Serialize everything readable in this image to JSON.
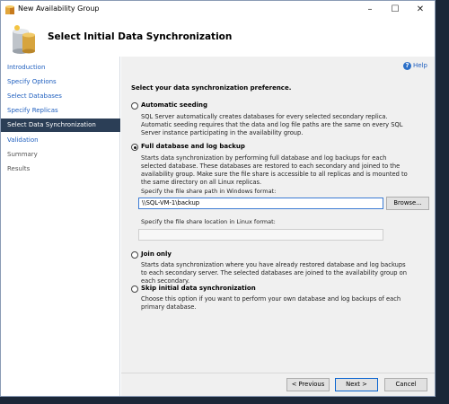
{
  "window": {
    "title": "New Availability Group"
  },
  "header": {
    "title": "Select Initial Data Synchronization"
  },
  "sidebar": {
    "items": [
      {
        "label": "Introduction"
      },
      {
        "label": "Specify Options"
      },
      {
        "label": "Select Databases"
      },
      {
        "label": "Specify Replicas"
      },
      {
        "label": "Select Data Synchronization"
      },
      {
        "label": "Validation"
      },
      {
        "label": "Summary"
      },
      {
        "label": "Results"
      }
    ]
  },
  "help": {
    "label": "Help"
  },
  "main": {
    "prompt": "Select your data synchronization preference.",
    "options": {
      "automatic": {
        "label": "Automatic seeding",
        "description": "SQL Server automatically creates databases for every selected secondary replica. Automatic seeding requires that the data and log file paths are the same on every SQL Server instance participating in the availability group."
      },
      "full": {
        "label": "Full database and log backup",
        "description": "Starts data synchronization by performing full database and log backups for each selected database. These databases are restored to each secondary and joined to the availability group. Make sure the file share is accessible to all replicas and is mounted to the same directory on all Linux replicas.",
        "windows_path_label": "Specify the file share path in Windows format:",
        "windows_path_value": "\\\\SQL-VM-1\\backup",
        "browse_label": "Browse...",
        "linux_path_label": "Specify the file share location in Linux format:",
        "linux_path_value": ""
      },
      "join": {
        "label": "Join only",
        "description": "Starts data synchronization where you have already restored database and log backups to each secondary server. The selected databases are joined to the availability group on each secondary."
      },
      "skip": {
        "label": "Skip initial data synchronization",
        "description": "Choose this option if you want to perform your own database and log backups of each primary database."
      }
    },
    "selected_option": "full"
  },
  "footer": {
    "previous_label": "< Previous",
    "next_label": "Next >",
    "cancel_label": "Cancel"
  }
}
